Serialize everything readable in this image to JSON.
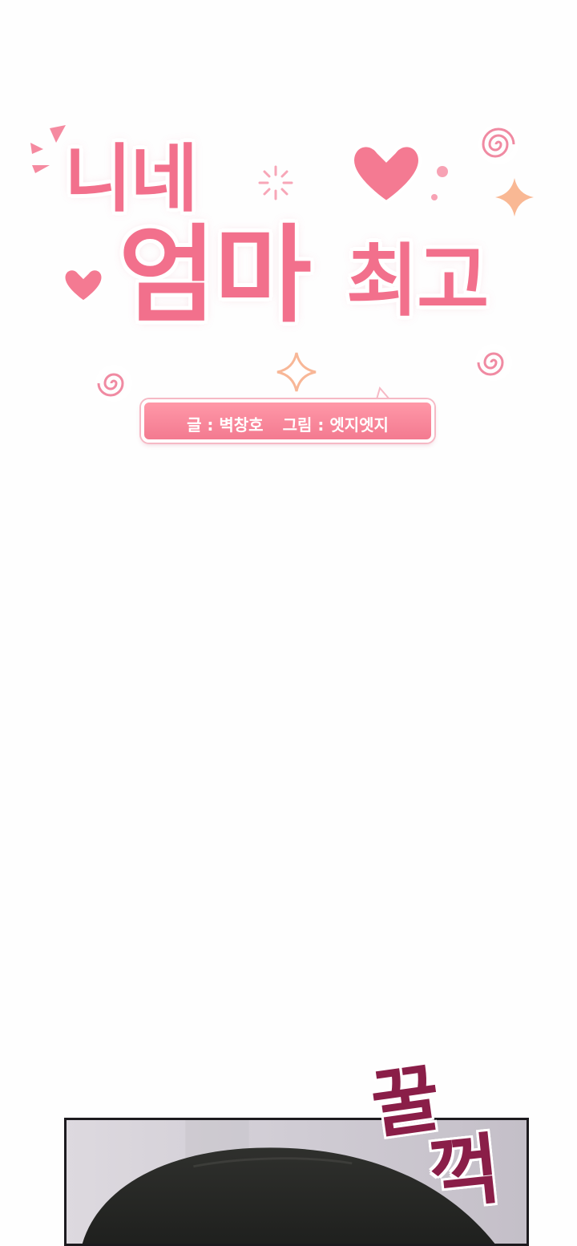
{
  "title": {
    "line1": "니네",
    "line2": "엄마",
    "line3": "최고"
  },
  "credits": {
    "writer_label": "글 : 벽창호",
    "artist_label": "그림 : 엣지엣지"
  },
  "sound_effect": {
    "top": "꿀",
    "bottom": "꺽"
  },
  "colors": {
    "title_pink": "#f2708c",
    "credit_box": "#f37a90",
    "sfx_maroon": "#8a1e48"
  }
}
